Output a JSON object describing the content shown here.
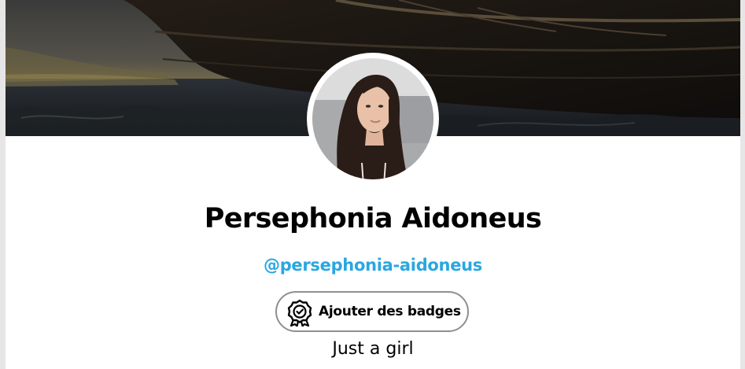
{
  "profile": {
    "name": "Persephonia Aidoneus",
    "handle": "@persephonia-aidoneus",
    "bio": "Just a girl"
  },
  "actions": {
    "add_badges_label": "Ajouter des badges"
  },
  "colors": {
    "handle": "#29a7e1",
    "button_border": "#8f8f8f",
    "page_bg": "#ffffff",
    "outer_bg": "#e6e6e6"
  },
  "icons": {
    "badge": "badge-award-icon"
  }
}
